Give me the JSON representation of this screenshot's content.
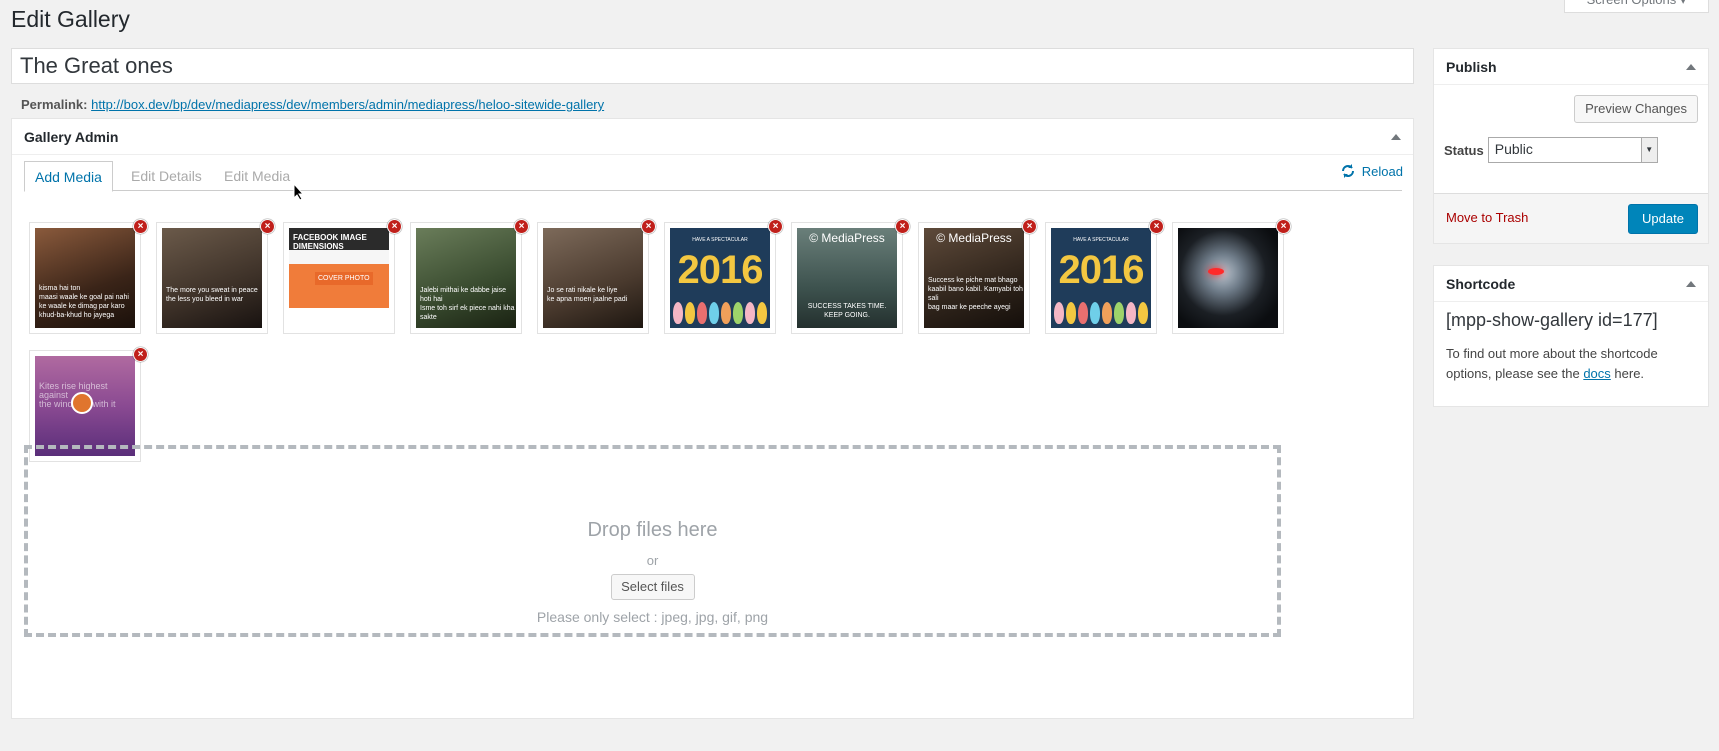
{
  "screen_options": {
    "label": "Screen Options ▾"
  },
  "page_title": "Edit Gallery",
  "title_value": "The Great ones",
  "permalink": {
    "label": "Permalink:",
    "url": "http://box.dev/bp/dev/mediapress/dev/members/admin/mediapress/heloo-sitewide-gallery"
  },
  "gallery_admin": {
    "title": "Gallery Admin",
    "tabs": [
      {
        "label": "Add Media",
        "active": true
      },
      {
        "label": "Edit Details",
        "active": false
      },
      {
        "label": "Edit Media",
        "active": false
      }
    ],
    "reload_label": "Reload",
    "thumbnails": [
      {
        "kind": "movie",
        "caption": "kisma hai ton\nmaasi waale ke goal pai nahi\nke waale ke dimag par karo\nkhud-ba-khud ho jayega"
      },
      {
        "kind": "movie",
        "caption": "The more you sweat in peace\nthe less you bleed in war"
      },
      {
        "kind": "facebook",
        "caption": "FACEBOOK IMAGE DIMENSIONS",
        "sub": "COVER PHOTO"
      },
      {
        "kind": "movie",
        "caption": "Jalebi mithai ke dabbe jaise hoti hai\nIsme toh sirf ek piece nahi kha sakte"
      },
      {
        "kind": "movie",
        "caption": "Jo se rati nikale ke liye\nke apna moen jaalne padi"
      },
      {
        "kind": "2016",
        "top": "HAVE A SPECTACULAR",
        "year": "2016"
      },
      {
        "kind": "lake",
        "watermark": "© MediaPress",
        "caption": "SUCCESS TAKES TIME.\nKEEP GOING."
      },
      {
        "kind": "movie-mp",
        "watermark": "© MediaPress",
        "caption": "Success ke piche mat bhago\nkaabil bano kabil. Kamyabi toh sali\nbag maar ke peeche ayegi"
      },
      {
        "kind": "2016",
        "top": "HAVE A SPECTACULAR",
        "year": "2016"
      },
      {
        "kind": "robot"
      },
      {
        "kind": "purple",
        "caption": "Kites rise highest against\nthe wind, not with it"
      }
    ],
    "dropzone": {
      "title": "Drop files here",
      "or": "or",
      "button": "Select files",
      "note": "Please only select : jpeg, jpg, gif, png"
    }
  },
  "publish": {
    "title": "Publish",
    "preview_button": "Preview Changes",
    "status_label": "Status",
    "status_value": "Public",
    "trash_label": "Move to Trash",
    "update_button": "Update"
  },
  "shortcode": {
    "title": "Shortcode",
    "code": "[mpp-show-gallery id=177]",
    "help_prefix": "To find out more about the shortcode options, please see the ",
    "help_link": "docs",
    "help_suffix": " here."
  },
  "colors": {
    "accent": "#0073aa",
    "update_button": "#0085ba",
    "delete": "#c0201b",
    "trash": "#a00"
  }
}
